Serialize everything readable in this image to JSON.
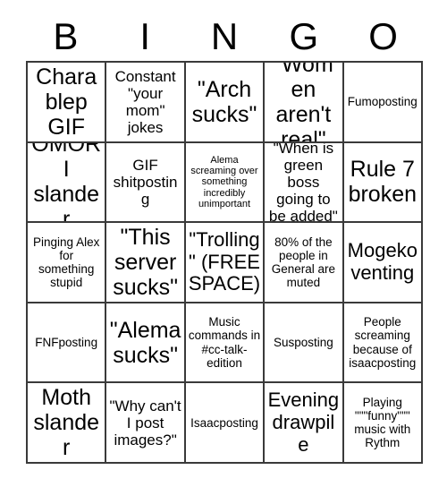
{
  "header": {
    "letters": [
      "B",
      "I",
      "N",
      "G",
      "O"
    ]
  },
  "grid": {
    "columns": 5,
    "rows": 5,
    "free_space_index": 12,
    "border_color": "#3a3a3a",
    "background_color": "#ffffff",
    "text_color": "#000000",
    "cells": [
      {
        "text": "Chara blep GIF",
        "size": "xl"
      },
      {
        "text": "Constant \"your mom\" jokes",
        "size": "md"
      },
      {
        "text": "\"Arch sucks\"",
        "size": "xl"
      },
      {
        "text": "\"Women aren't real\"",
        "size": "xl"
      },
      {
        "text": "Fumoposting",
        "size": "sm"
      },
      {
        "text": "OMORI slander",
        "size": "xl"
      },
      {
        "text": "GIF shitposting",
        "size": "md"
      },
      {
        "text": "Alema screaming over something incredibly unimportant",
        "size": "xs"
      },
      {
        "text": "\"When is green boss going to be added\"",
        "size": "md"
      },
      {
        "text": "Rule 7 broken",
        "size": "xl"
      },
      {
        "text": "Pinging Alex for something stupid",
        "size": "sm"
      },
      {
        "text": "\"This server sucks\"",
        "size": "xl"
      },
      {
        "text": "\"Trolling\" (FREE SPACE)",
        "size": "lg"
      },
      {
        "text": "80% of the people in General are muted",
        "size": "sm"
      },
      {
        "text": "Mogeko venting",
        "size": "lg"
      },
      {
        "text": "FNFposting",
        "size": "sm"
      },
      {
        "text": "\"Alema sucks\"",
        "size": "xl"
      },
      {
        "text": "Music commands in #cc-talk-edition",
        "size": "sm"
      },
      {
        "text": "Susposting",
        "size": "sm"
      },
      {
        "text": "People screaming because of isaacposting",
        "size": "sm"
      },
      {
        "text": "Moth slander",
        "size": "xl"
      },
      {
        "text": "\"Why can't I post images?\"",
        "size": "md"
      },
      {
        "text": "Isaacposting",
        "size": "sm"
      },
      {
        "text": "Evening drawpile",
        "size": "lg"
      },
      {
        "text": "Playing \"\"\"funny\"\"\" music with Rythm",
        "size": "sm"
      }
    ]
  }
}
